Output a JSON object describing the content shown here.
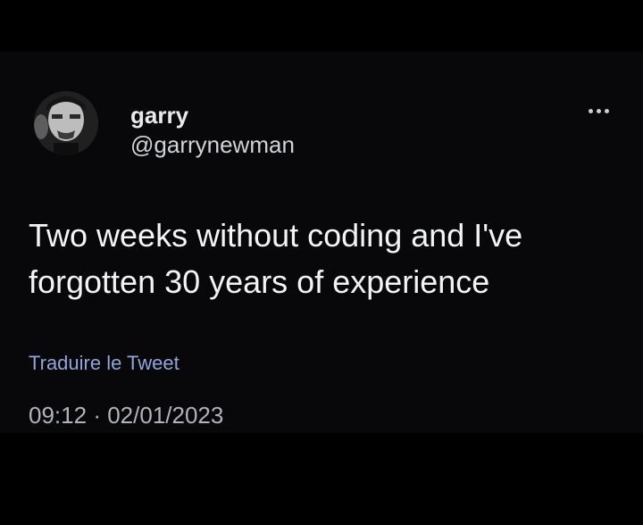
{
  "tweet": {
    "author": {
      "display_name": "garry",
      "handle": "@garrynewman",
      "avatar_icon": "profile-photo"
    },
    "more_icon": "more-dots-icon",
    "text_lines": [
      "Two weeks without coding and I've",
      "forgotten 30 years of experience"
    ],
    "translate_label": "Traduire le Tweet",
    "time": "09:12",
    "separator": "·",
    "date": "02/01/2023"
  },
  "colors": {
    "background": "#000000",
    "card": "#08070a",
    "text": "#f2f3f4",
    "link": "#8ea6d9",
    "muted": "#b0b4b8"
  }
}
